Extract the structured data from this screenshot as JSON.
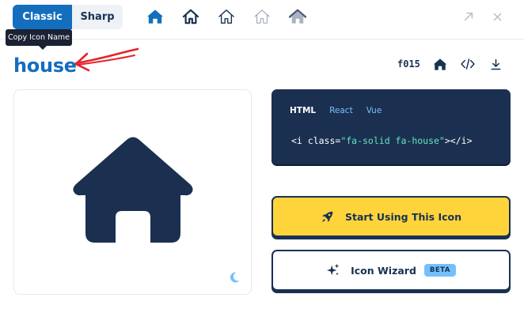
{
  "top_bar": {
    "families": [
      {
        "label": "Classic",
        "active": true
      },
      {
        "label": "Sharp",
        "active": false
      }
    ],
    "style_icons": [
      "house-solid-icon",
      "house-regular-icon",
      "house-light-icon",
      "house-thin-icon",
      "house-duotone-icon"
    ],
    "controls": [
      "expand-icon",
      "close-icon"
    ]
  },
  "tooltip": {
    "text": "Copy Icon Name"
  },
  "icon": {
    "name": "house",
    "unicode": "f015"
  },
  "code": {
    "tabs": [
      {
        "label": "HTML",
        "active": true
      },
      {
        "label": "React",
        "active": false
      },
      {
        "label": "Vue",
        "active": false
      }
    ],
    "snippet_prefix": "<i class=",
    "snippet_value": "\"fa-solid fa-house\"",
    "snippet_suffix": "></i>"
  },
  "actions": {
    "start_label": "Start Using This Icon",
    "wizard_label": "Icon Wizard",
    "wizard_badge": "BETA"
  },
  "colors": {
    "brand_blue": "#146ebe",
    "navy": "#183153",
    "code_bg": "#1b3050",
    "yellow": "#ffd43b",
    "annotation_red": "#e4222a",
    "light_blue": "#74c0fc"
  }
}
